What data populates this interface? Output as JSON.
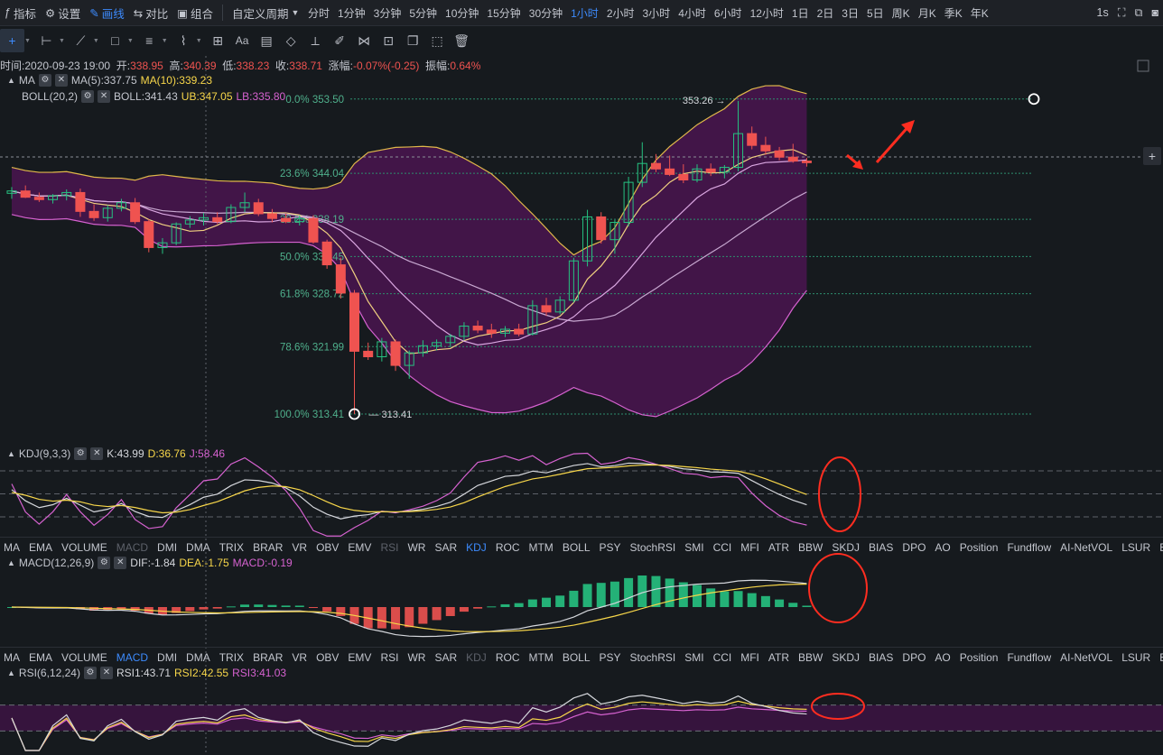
{
  "topbar": {
    "left": [
      {
        "icon": "indicator-icon",
        "label": "指标"
      },
      {
        "icon": "settings-icon",
        "label": "设置"
      },
      {
        "icon": "pen-icon",
        "label": "画线",
        "active": true
      },
      {
        "icon": "compare-icon",
        "label": "对比"
      },
      {
        "icon": "combine-icon",
        "label": "组合"
      }
    ],
    "custom_period": "自定义周期",
    "periods": [
      "分时",
      "1分钟",
      "3分钟",
      "5分钟",
      "10分钟",
      "15分钟",
      "30分钟",
      "1小时",
      "2小时",
      "3小时",
      "4小时",
      "6小时",
      "12小时",
      "1日",
      "2日",
      "3日",
      "5日",
      "周K",
      "月K",
      "季K",
      "年K"
    ],
    "active_period": "1小时",
    "right_label": "1s"
  },
  "toolbar2": {
    "tools": [
      "crosshair-icon",
      "horizontal-line-icon",
      "trend-line-icon",
      "rectangle-icon",
      "parallel-channel-icon",
      "wave-icon",
      "grid-icon",
      "text-icon",
      "fib-icon",
      "eraser-icon",
      "ruler-icon",
      "brush-icon",
      "pattern-icon",
      "lock-icon",
      "copy-icon",
      "screenshot-icon",
      "delete-icon"
    ],
    "text_tool_label": "Aa"
  },
  "ohlc": {
    "time_label": "时间:",
    "time": "2020-09-23 19:00",
    "open_label": "开:",
    "open": "338.95",
    "high_label": "高:",
    "high": "340.39",
    "low_label": "低:",
    "low": "338.23",
    "close_label": "收:",
    "close": "338.71",
    "change_label": "涨幅:",
    "change": "-0.07%(-0.25)",
    "amp_label": "振幅:",
    "amp": "0.64%"
  },
  "ma_legend": {
    "name": "MA",
    "ma5": "MA(5):337.75",
    "ma10": "MA(10):339.23"
  },
  "boll_legend": {
    "name": "BOLL(20,2)",
    "boll": "BOLL:341.43",
    "ub": "UB:347.05",
    "lb": "LB:335.80"
  },
  "fib_levels": [
    {
      "label": "0.0% 353.50",
      "price": 353.5
    },
    {
      "label": "23.6% 344.04",
      "price": 344.04
    },
    {
      "label": "38.2% 338.19",
      "price": 338.19
    },
    {
      "label": "50.0% 333.45",
      "price": 333.45
    },
    {
      "label": "61.8% 328.72",
      "price": 328.72
    },
    {
      "label": "78.6% 321.99",
      "price": 321.99
    },
    {
      "label": "100.0% 313.41",
      "price": 313.41
    }
  ],
  "price_marks": {
    "high": "353.26",
    "low": "313.41"
  },
  "kdj_legend": {
    "name": "KDJ(9,3,3)",
    "k": "K:43.99",
    "d": "D:36.76",
    "j": "J:58.46"
  },
  "macd_legend": {
    "name": "MACD(12,26,9)",
    "dif": "DIF:-1.84",
    "dea": "DEA:-1.75",
    "macd": "MACD:-0.19"
  },
  "rsi_legend": {
    "name": "RSI(6,12,24)",
    "rsi1": "RSI1:43.71",
    "rsi2": "RSI2:42.55",
    "rsi3": "RSI3:41.03"
  },
  "indicator_tabs": [
    "MA",
    "EMA",
    "VOLUME",
    "MACD",
    "DMI",
    "DMA",
    "TRIX",
    "BRAR",
    "VR",
    "OBV",
    "EMV",
    "RSI",
    "WR",
    "SAR",
    "KDJ",
    "ROC",
    "MTM",
    "BOLL",
    "PSY",
    "StochRSI",
    "SMI",
    "CCI",
    "MFI",
    "ATR",
    "BBW",
    "SKDJ",
    "BIAS",
    "DPO",
    "AO",
    "Position",
    "Fundflow",
    "AI-NetVOL",
    "LSUR",
    "BASIS"
  ],
  "indicator_bar_1": {
    "active": "KDJ",
    "dim": [
      "MACD",
      "RSI"
    ]
  },
  "indicator_bar_2": {
    "active": "MACD",
    "dim": [
      "KDJ"
    ]
  },
  "colors": {
    "up": "#26c281",
    "down": "#ef5350",
    "ma5": "#f7d64a",
    "ma10": "#d662d0",
    "boll_fill": "#4a1550",
    "accent": "#3d8bfd"
  },
  "chart_data": {
    "type": "candlestick",
    "ylim": [
      311,
      356
    ],
    "candles": [
      [
        341.5,
        342.3,
        340.8,
        341.8
      ],
      [
        341.8,
        342.5,
        340.9,
        341.0
      ],
      [
        341.0,
        341.6,
        340.4,
        340.7
      ],
      [
        340.7,
        341.4,
        340.2,
        341.2
      ],
      [
        341.2,
        342.0,
        340.6,
        341.6
      ],
      [
        341.6,
        342.1,
        338.5,
        339.2
      ],
      [
        339.2,
        340.1,
        338.0,
        338.4
      ],
      [
        338.4,
        340.0,
        337.9,
        339.6
      ],
      [
        339.6,
        340.8,
        339.2,
        340.3
      ],
      [
        340.3,
        340.9,
        337.6,
        337.9
      ],
      [
        337.9,
        338.2,
        334.0,
        334.6
      ],
      [
        334.6,
        335.8,
        333.8,
        335.2
      ],
      [
        335.2,
        337.8,
        334.9,
        337.6
      ],
      [
        337.6,
        338.6,
        337.1,
        338.1
      ],
      [
        338.1,
        339.0,
        337.4,
        338.4
      ],
      [
        338.4,
        339.1,
        337.6,
        337.9
      ],
      [
        337.9,
        340.1,
        337.7,
        339.7
      ],
      [
        339.7,
        341.6,
        339.1,
        340.3
      ],
      [
        340.3,
        340.8,
        338.6,
        338.9
      ],
      [
        338.9,
        339.5,
        337.8,
        338.3
      ],
      [
        338.3,
        338.9,
        337.7,
        337.9
      ],
      [
        337.9,
        338.7,
        337.4,
        338.3
      ],
      [
        338.3,
        338.7,
        335.1,
        335.3
      ],
      [
        335.3,
        335.6,
        331.9,
        332.4
      ],
      [
        332.4,
        333.3,
        328.1,
        328.8
      ],
      [
        328.8,
        329.2,
        313.41,
        321.4
      ],
      [
        321.4,
        322.5,
        320.3,
        320.7
      ],
      [
        320.7,
        323.1,
        320.1,
        322.6
      ],
      [
        322.6,
        322.9,
        318.9,
        319.6
      ],
      [
        319.6,
        321.5,
        317.9,
        321.2
      ],
      [
        321.2,
        322.8,
        320.7,
        322.1
      ],
      [
        322.1,
        322.9,
        321.5,
        322.5
      ],
      [
        322.5,
        323.6,
        321.9,
        323.3
      ],
      [
        323.3,
        325.1,
        322.8,
        324.6
      ],
      [
        324.6,
        325.3,
        323.7,
        324.1
      ],
      [
        324.1,
        324.9,
        323.1,
        323.7
      ],
      [
        323.7,
        324.6,
        323.2,
        324.2
      ],
      [
        324.2,
        324.9,
        323.3,
        323.6
      ],
      [
        323.6,
        327.9,
        323.4,
        327.2
      ],
      [
        327.2,
        328.2,
        325.9,
        326.4
      ],
      [
        326.4,
        328.4,
        326.1,
        327.9
      ],
      [
        327.9,
        333.3,
        327.6,
        332.9
      ],
      [
        332.9,
        339.4,
        332.2,
        338.5
      ],
      [
        338.5,
        339.1,
        335.1,
        335.6
      ],
      [
        335.6,
        338.1,
        333.8,
        337.8
      ],
      [
        337.8,
        343.6,
        337.3,
        342.9
      ],
      [
        342.9,
        348.0,
        342.3,
        345.3
      ],
      [
        345.3,
        346.5,
        344.2,
        344.6
      ],
      [
        344.6,
        346.3,
        343.7,
        343.9
      ],
      [
        343.9,
        345.2,
        342.8,
        343.2
      ],
      [
        343.2,
        345.2,
        342.9,
        344.6
      ],
      [
        344.6,
        345.3,
        343.7,
        344.2
      ],
      [
        344.2,
        345.1,
        343.4,
        344.8
      ],
      [
        344.8,
        353.26,
        344.3,
        349.1
      ],
      [
        349.1,
        350.0,
        347.1,
        347.6
      ],
      [
        347.6,
        348.7,
        346.4,
        346.9
      ],
      [
        346.9,
        347.4,
        345.7,
        346.1
      ],
      [
        346.1,
        347.8,
        345.4,
        345.6
      ],
      [
        345.6,
        346.0,
        344.9,
        345.4
      ]
    ]
  }
}
